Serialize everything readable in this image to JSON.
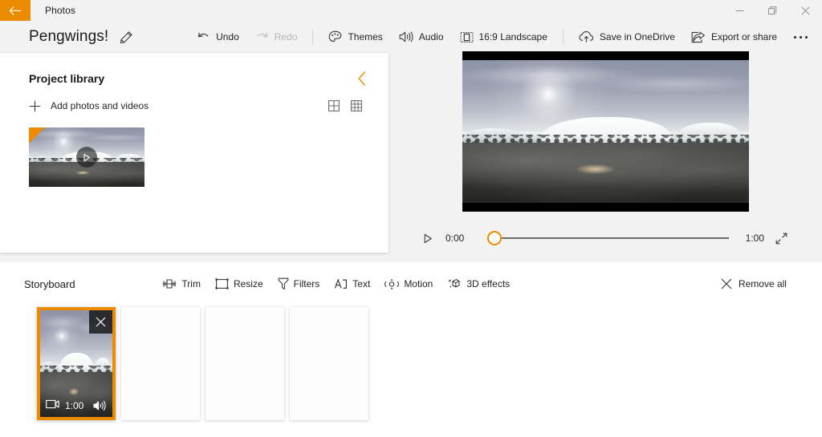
{
  "titlebar": {
    "back_icon": "back-arrow-icon",
    "app_name": "Photos",
    "minimize_label": "—",
    "maximize_icon": "restore-icon",
    "close_icon": "close-icon"
  },
  "commandbar": {
    "project_title": "Pengwings!",
    "edit_icon": "pencil-icon",
    "items": [
      {
        "label": "Undo",
        "icon": "undo-icon",
        "disabled": false
      },
      {
        "label": "Redo",
        "icon": "redo-icon",
        "disabled": true
      },
      {
        "label": "Themes",
        "icon": "palette-icon",
        "disabled": false
      },
      {
        "label": "Audio",
        "icon": "speaker-icon",
        "disabled": false
      },
      {
        "label": "16:9 Landscape",
        "icon": "aspect-ratio-icon",
        "disabled": false
      },
      {
        "label": "Save in OneDrive",
        "icon": "cloud-upload-icon",
        "disabled": false
      },
      {
        "label": "Export or share",
        "icon": "share-icon",
        "disabled": false
      }
    ],
    "more_icon": "more-options-icon"
  },
  "library": {
    "title": "Project library",
    "collapse_icon": "chevron-left-icon",
    "add_label": "Add photos and videos",
    "add_icon": "plus-icon",
    "view_large_icon": "grid-large-icon",
    "view_small_icon": "grid-small-icon",
    "items": [
      {
        "name": "library-thumbnail-pengwings",
        "play_icon": "play-icon",
        "selected": true
      }
    ]
  },
  "preview": {
    "play_icon": "play-icon",
    "current_time": "0:00",
    "total_time": "1:00",
    "fullscreen_icon": "fullscreen-icon",
    "progress_percent": 0
  },
  "storyboard": {
    "title": "Storyboard",
    "tools": [
      {
        "label": "Trim",
        "icon": "trim-icon"
      },
      {
        "label": "Resize",
        "icon": "resize-icon"
      },
      {
        "label": "Filters",
        "icon": "filter-icon"
      },
      {
        "label": "Text",
        "icon": "text-icon"
      },
      {
        "label": "Motion",
        "icon": "motion-icon"
      },
      {
        "label": "3D effects",
        "icon": "cube-sparkle-icon"
      }
    ],
    "remove_all": {
      "label": "Remove all",
      "icon": "close-x-icon"
    },
    "cards": [
      {
        "name": "storyboard-card-pengwings",
        "selected": true,
        "duration": "1:00",
        "close_icon": "close-x-icon",
        "media_type_icon": "video-icon",
        "audio_icon": "speaker-on-icon"
      },
      {
        "name": "storyboard-card-empty-1",
        "selected": false
      },
      {
        "name": "storyboard-card-empty-2",
        "selected": false
      },
      {
        "name": "storyboard-card-empty-3",
        "selected": false
      }
    ]
  },
  "colors": {
    "accent": "#ed8b00",
    "surface": "#ffffff",
    "background": "#f2f2f2",
    "text": "#242424"
  }
}
